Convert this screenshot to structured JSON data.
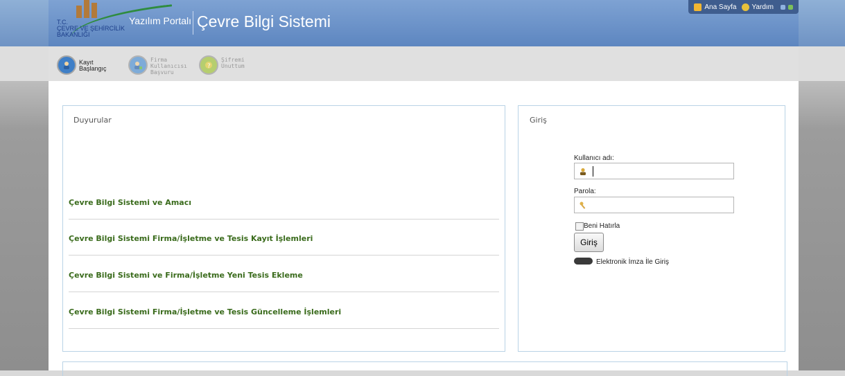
{
  "header": {
    "logo_lines": [
      "T.C.",
      "ÇEVRE VE ŞEHİRCİLİK",
      "BAKANLIĞI"
    ],
    "portal_label": "Yazılım Portalı",
    "system_title": "Çevre Bilgi Sistemi",
    "top_links": {
      "home": "Ana Sayfa",
      "help": "Yardım"
    }
  },
  "toolbar": {
    "items": [
      {
        "label_line1": "Kayıt",
        "label_line2": "Başlangıç",
        "line3": "",
        "icon": "user-card-icon",
        "enabled": true
      },
      {
        "label_line1": "Firma",
        "label_line2": "Kullanıcısı",
        "line3": "Başvuru",
        "icon": "user-add-icon",
        "enabled": false
      },
      {
        "label_line1": "Şifremi",
        "label_line2": "Unuttum",
        "line3": "",
        "icon": "key-question-icon",
        "enabled": false
      }
    ]
  },
  "announcements": {
    "title": "Duyurular",
    "items": [
      "Çevre Bilgi Sistemi ve Amacı",
      "Çevre Bilgi Sistemi Firma/İşletme ve Tesis Kayıt İşlemleri",
      "Çevre Bilgi Sistemi ve Firma/İşletme Yeni Tesis Ekleme",
      "Çevre Bilgi Sistemi Firma/İşletme ve Tesis Güncelleme İşlemleri"
    ]
  },
  "login": {
    "title": "Giriş",
    "username_label": "Kullanıcı adı:",
    "username_value": "",
    "password_label": "Parola:",
    "password_value": "",
    "remember_label": "Beni Hatırla",
    "remember_checked": false,
    "submit_label": "Giriş",
    "esign_label": "Elektronik İmza İle Giriş"
  },
  "notice": {
    "text": ""
  },
  "colors": {
    "header_blue": "#6f93c4",
    "link_green": "#3a6b1c",
    "panel_border": "#b9d3e6",
    "notice_red": "#dd2222"
  }
}
